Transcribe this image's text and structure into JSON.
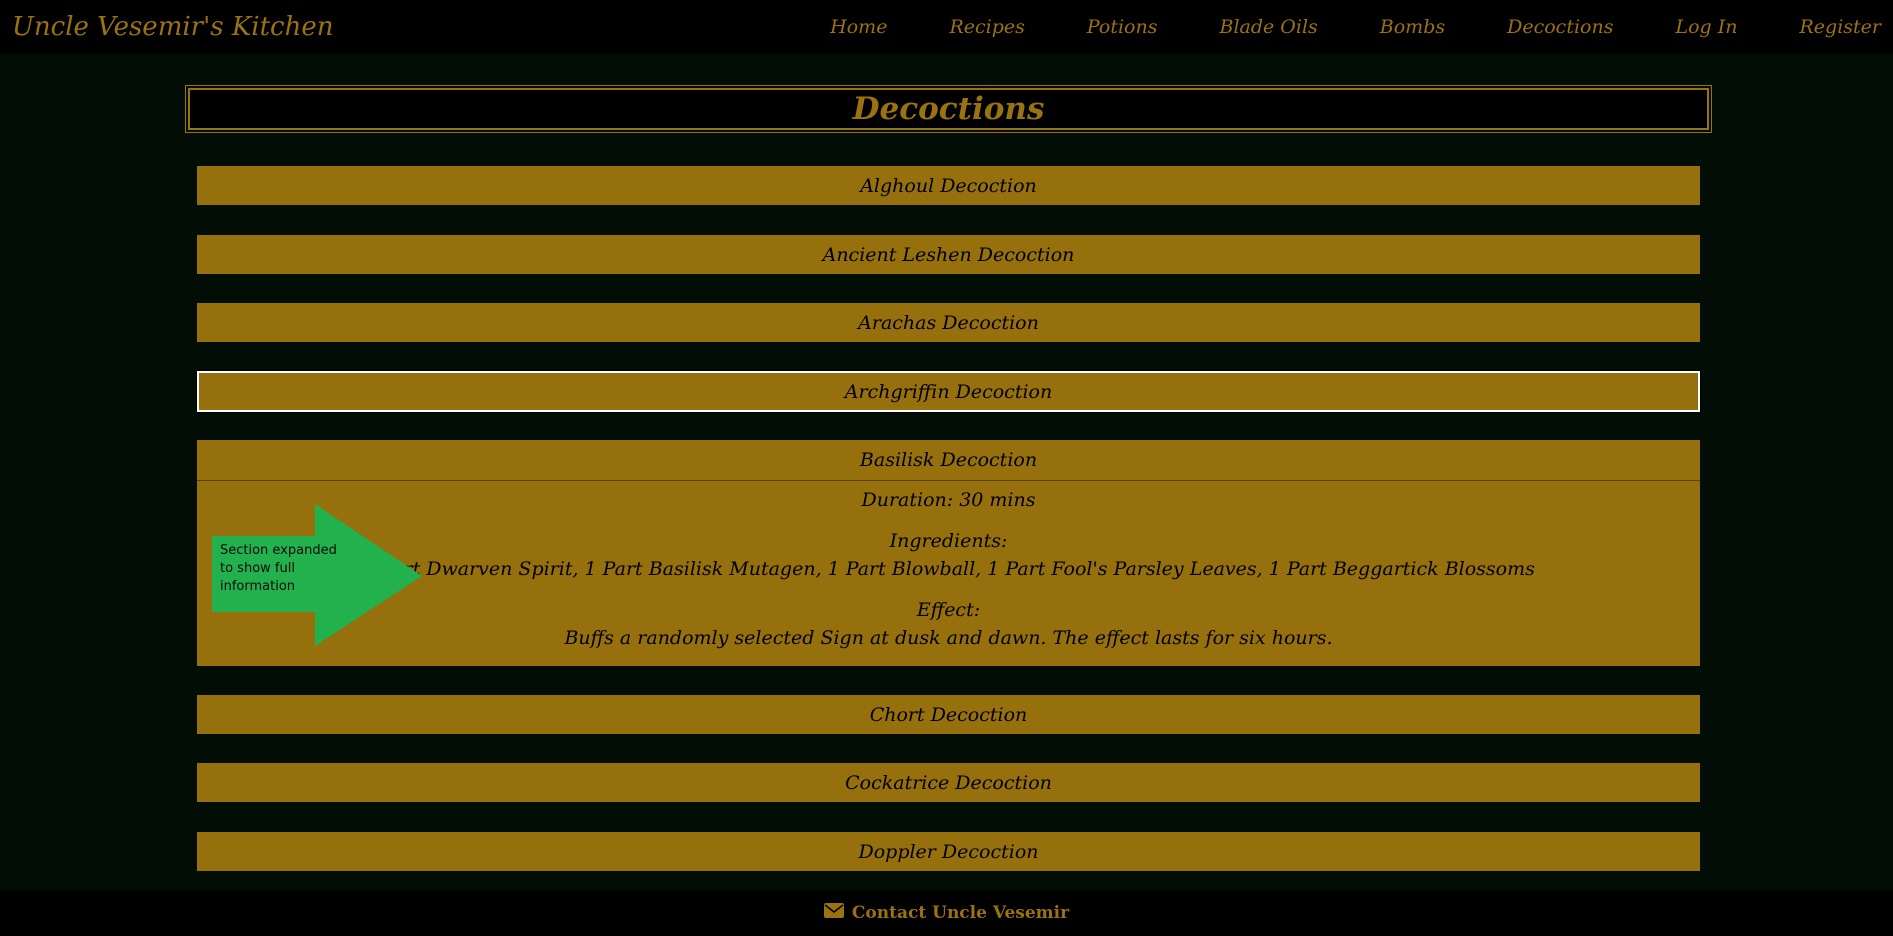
{
  "navbar": {
    "brand": "Uncle Vesemir's Kitchen",
    "links": [
      "Home",
      "Recipes",
      "Potions",
      "Blade Oils",
      "Bombs",
      "Decoctions",
      "Log In",
      "Register"
    ]
  },
  "page": {
    "title": "Decoctions"
  },
  "accordion": [
    "Alghoul Decoction",
    "Ancient Leshen Decoction",
    "Arachas Decoction",
    "Archgriffin Decoction",
    "Basilisk Decoction",
    "Chort Decoction",
    "Cockatrice Decoction",
    "Doppler Decoction"
  ],
  "expanded": {
    "duration": "Duration: 30 mins",
    "ingredients_label": "Ingredients:",
    "ingredients": "1 Part Dwarven Spirit, 1 Part Basilisk Mutagen, 1 Part Blowball, 1 Part Fool's Parsley Leaves, 1 Part Beggartick Blossoms",
    "effect_label": "Effect:",
    "effect": "Buffs a randomly selected Sign at dusk and dawn. The effect lasts for six hours."
  },
  "annotation": {
    "text": "Section expanded to show full information"
  },
  "footer": {
    "contact": "Contact Uncle Vesemir",
    "icon": "envelope-icon"
  },
  "colors": {
    "gold": "#95700d",
    "title_gold": "#9b7210",
    "background": "#020d06",
    "arrow": "#22b14c"
  }
}
